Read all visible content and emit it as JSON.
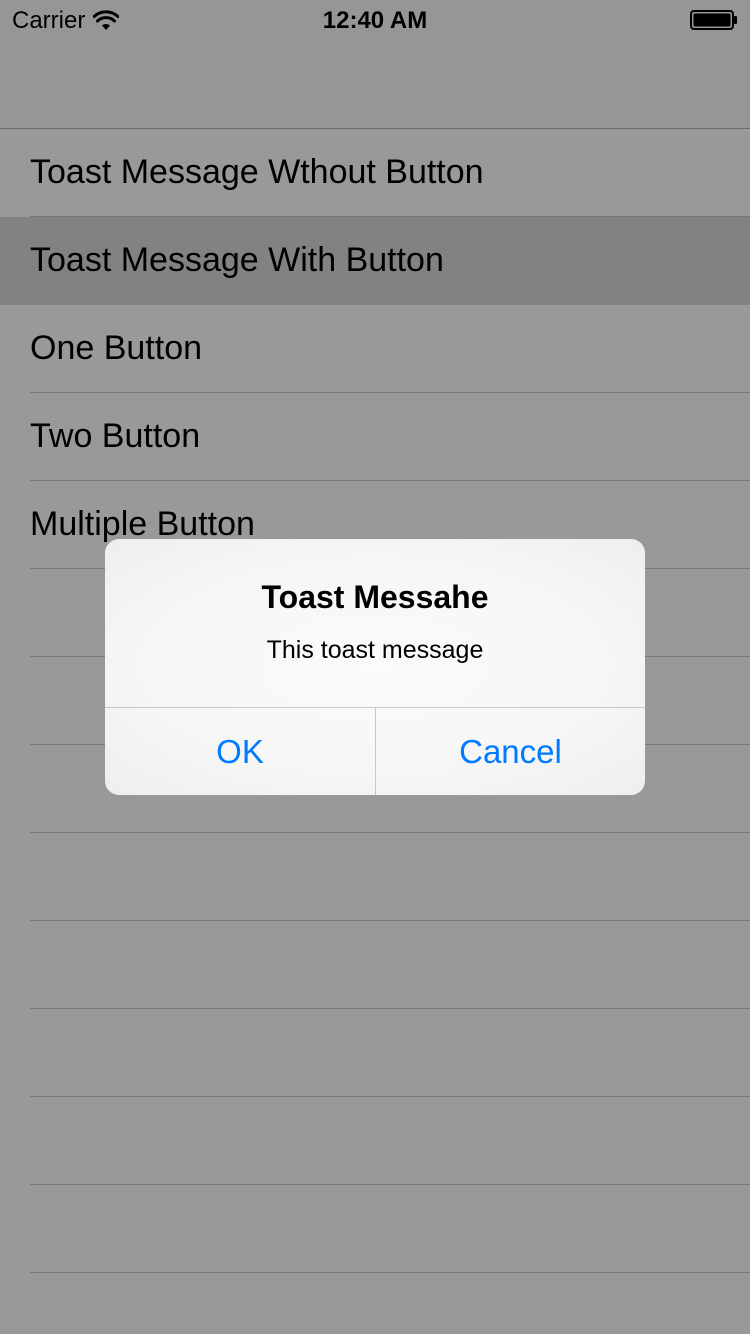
{
  "status_bar": {
    "carrier": "Carrier",
    "time": "12:40 AM",
    "wifi_icon": "wifi-icon",
    "battery_icon": "battery-icon"
  },
  "table": {
    "rows": [
      {
        "label": "Toast Message Wthout Button",
        "selected": false
      },
      {
        "label": "Toast Message With Button",
        "selected": true
      },
      {
        "label": "One Button",
        "selected": false
      },
      {
        "label": "Two Button",
        "selected": false
      },
      {
        "label": "Multiple Button",
        "selected": false
      },
      {
        "label": "",
        "selected": false
      },
      {
        "label": "",
        "selected": false
      },
      {
        "label": "",
        "selected": false
      },
      {
        "label": "",
        "selected": false
      },
      {
        "label": "",
        "selected": false
      },
      {
        "label": "",
        "selected": false
      },
      {
        "label": "",
        "selected": false
      },
      {
        "label": "",
        "selected": false
      },
      {
        "label": "",
        "selected": false
      }
    ]
  },
  "alert": {
    "title": "Toast Messahe",
    "message": "This toast message",
    "ok_label": "OK",
    "cancel_label": "Cancel"
  },
  "colors": {
    "accent": "#007aff",
    "overlay": "rgba(0,0,0,0.40)"
  }
}
